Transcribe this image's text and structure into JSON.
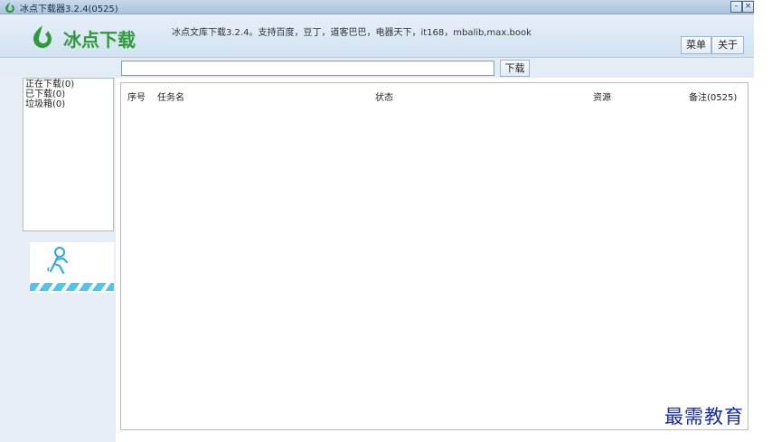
{
  "window": {
    "title": "冰点下载器3.2.4(0525)",
    "minimize_glyph": "–",
    "close_glyph": "×"
  },
  "header": {
    "logo_text": "冰点下载",
    "tagline": "冰点文库下载3.2.4。支持百度，豆丁，道客巴巴，电器天下，it168，mbalib,max.book",
    "menu_label": "菜单",
    "about_label": "关于"
  },
  "toolbar": {
    "url_value": "",
    "download_label": "下载"
  },
  "sidebar": {
    "items": [
      {
        "label": "正在下载(0)"
      },
      {
        "label": "已下载(0)"
      },
      {
        "label": "垃圾箱(0)"
      }
    ]
  },
  "table": {
    "columns": [
      "序号",
      "任务名",
      "状态",
      "资源",
      "备注(0525)"
    ],
    "rows": []
  },
  "watermark": "最需教育",
  "colors": {
    "brand_green": "#2f9a3c",
    "accent_blue": "#4fc4ef",
    "watermark": "#1a2caa"
  }
}
